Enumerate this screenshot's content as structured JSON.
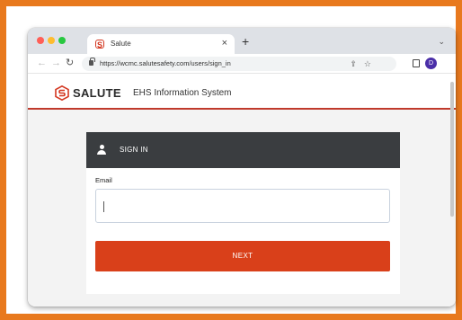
{
  "browser": {
    "tab_title": "Salute",
    "tab_close": "×",
    "new_tab": "+",
    "tab_menu": "⌄",
    "back": "←",
    "forward": "→",
    "reload": "↻",
    "url": "https://wcmc.salutesafety.com/users/sign_in",
    "share": "⇪",
    "star": "☆",
    "profile_initial": "D"
  },
  "site": {
    "logo_text": "SALUTE",
    "system_name": "EHS Information System",
    "brand_color": "#d3361f"
  },
  "signin": {
    "title": "SIGN IN",
    "email_label": "Email",
    "email_value": "",
    "next_label": "NEXT",
    "button_color": "#d9401a"
  },
  "frame": {
    "border_color": "#e8791e"
  }
}
